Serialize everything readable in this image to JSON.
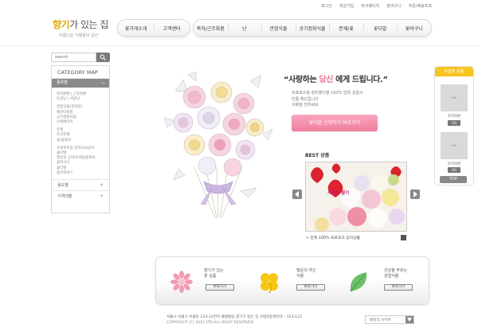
{
  "topbar": [
    "로그인",
    "회원가입",
    "마이페이지",
    "장바구니",
    "주문/배송조회"
  ],
  "logo": {
    "title_accent": "향기",
    "title_rest": "가 있는 집",
    "subtitle": "아름다운 식물들의 공간"
  },
  "nav": {
    "group1": [
      "꽃가게소개",
      "고객센터"
    ],
    "group2": [
      "축하/근조화환",
      "난",
      "관엽식물",
      "공기정화식물",
      "분재/꽃",
      "꽃다발",
      "꽃바구니"
    ]
  },
  "search": {
    "placeholder": "search"
  },
  "category_map": {
    "title": "CATEGORY MAP",
    "section1": "종류별",
    "items": [
      "축하화환 | 근조화환",
      "동양난 | 서양난",
      "",
      "관엽식물(일대일)",
      "베란다정원",
      "공기정화식물",
      "산세베리아",
      "",
      "분재",
      "조각분재",
      "꽃/꽃묶작",
      "",
      "프로포즈용 장미100송이",
      "꽃다발",
      "행운의 공작미/네잎클로바",
      "꽃바구니",
      "꽃다발",
      "플라워박스"
    ],
    "section2": "용도별",
    "section3": "가격대별"
  },
  "hero": {
    "headline_pre": "“사랑하는 ",
    "headline_accent": "당신",
    "headline_post": " 에게 드립니다.”",
    "desc": [
      "프로포즈용 장미꽃다발 103% 만족 웃합시",
      "빈틈 헤드립니다",
      "사랑을 전하세요"
    ],
    "button": "꽃다발 신청하기 바로가기"
  },
  "best": {
    "label": "BEST 상품",
    "image_text": "사랑의 향기",
    "caption": "> 만족 100% 프로포즈 장미상품"
  },
  "today": {
    "title": "오늘본 상품",
    "items": [
      {
        "thumb": "IMG",
        "caption": "축하화환",
        "go": "GO"
      },
      {
        "thumb": "IMG",
        "caption": "축하화환",
        "go": "GO"
      }
    ],
    "top": "TOP"
  },
  "promo": [
    {
      "title1": "향기가 있는",
      "title2": "꽃 상품",
      "button": "바로가기"
    },
    {
      "title1": "행운의 여신",
      "title2": "식물",
      "button": "바로가기"
    },
    {
      "title1": "건강을 부르는",
      "title2": "관엽식물",
      "button": "바로가기"
    }
  ],
  "footer": {
    "address": "서울시 서울구 서울동 123-12번지 클럽빌딩 향기가 있는 집 사업자등록번호 : 123-123",
    "copyright": "COPYRIGHT (C) 2011 LTD ALL RIGHT RESERVED",
    "family_site": "패밀리 사이트"
  },
  "colors": {
    "accent_yellow": "#e8a600",
    "accent_pink": "#ee7d9d",
    "today_yellow": "#f7c520"
  }
}
